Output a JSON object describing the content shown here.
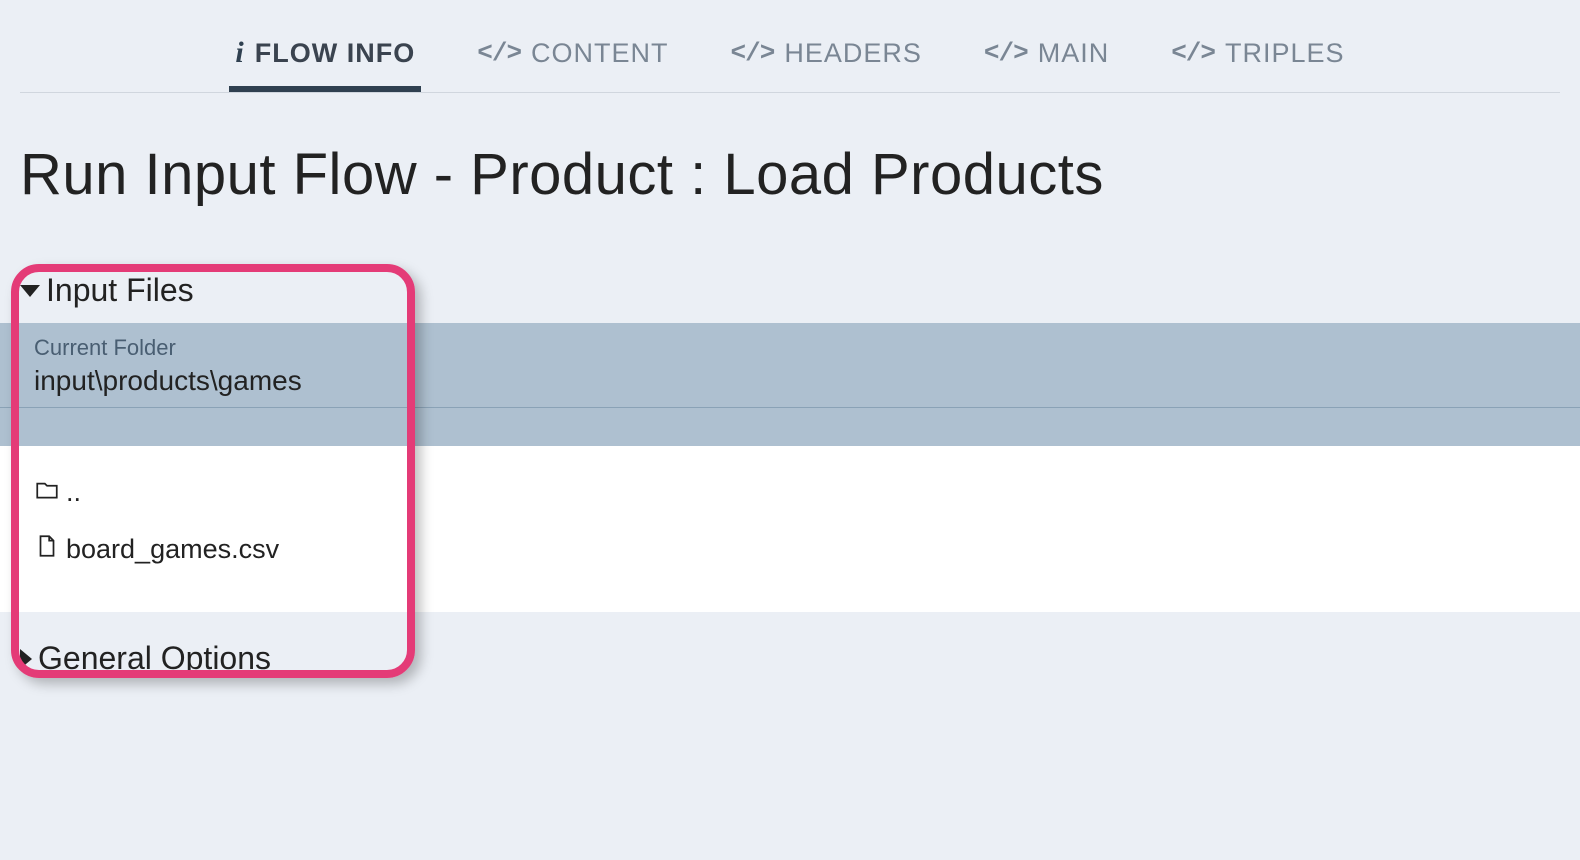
{
  "tabs": {
    "flow_info": "FLOW INFO",
    "content": "CONTENT",
    "headers": "HEADERS",
    "main": "MAIN",
    "triples": "TRIPLES"
  },
  "page_title": "Run Input Flow - Product : Load Products",
  "sections": {
    "input_files": {
      "title": "Input Files",
      "current_folder_label": "Current Folder",
      "current_folder_path": "input\\products\\games",
      "items": [
        {
          "name": "..",
          "kind": "folder"
        },
        {
          "name": "board_games.csv",
          "kind": "file"
        }
      ]
    },
    "general_options": {
      "title": "General Options"
    }
  }
}
